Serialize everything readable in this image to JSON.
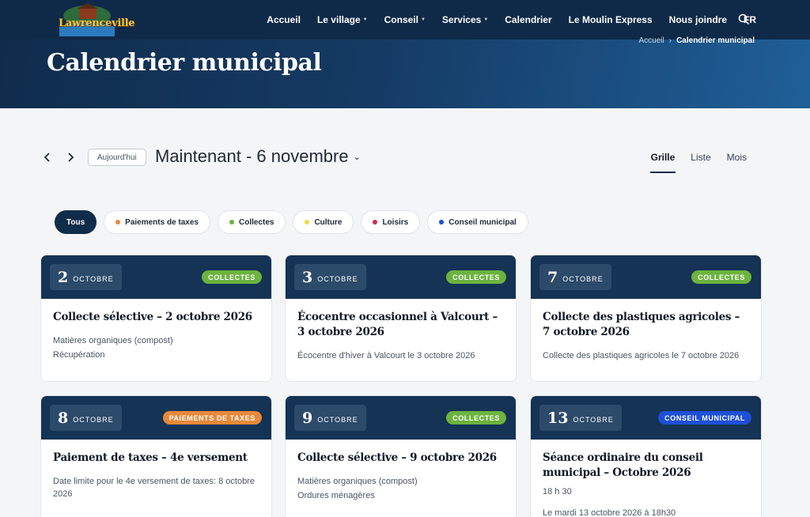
{
  "site": {
    "logo_text": "Lawrenceville"
  },
  "nav": [
    {
      "label": "Accueil",
      "caret": false
    },
    {
      "label": "Le village",
      "caret": true
    },
    {
      "label": "Conseil",
      "caret": true
    },
    {
      "label": "Services",
      "caret": true
    },
    {
      "label": "Calendrier",
      "caret": false
    },
    {
      "label": "Le Moulin Express",
      "caret": false
    },
    {
      "label": "Nous joindre",
      "caret": false
    },
    {
      "label": "FR",
      "caret": false
    }
  ],
  "breadcrumb": {
    "home": "Accueil",
    "separator": "›",
    "current": "Calendrier municipal"
  },
  "page": {
    "title": "Calendrier municipal"
  },
  "toolbar": {
    "today_label": "Aujourd'hui",
    "range_title": "Maintenant - 6 novembre",
    "views": [
      "Grille",
      "Liste",
      "Mois"
    ],
    "active_view": "Grille"
  },
  "filters": [
    {
      "label": "Tous",
      "color": null,
      "active": true
    },
    {
      "label": "Paiements de taxes",
      "color": "#e8893a"
    },
    {
      "label": "Collectes",
      "color": "#6cb33f"
    },
    {
      "label": "Culture",
      "color": "#f2d93b"
    },
    {
      "label": "Loisirs",
      "color": "#d6264f"
    },
    {
      "label": "Conseil municipal",
      "color": "#1e4fd6"
    }
  ],
  "events": [
    {
      "day": "2",
      "month": "OCTOBRE",
      "badge": "COLLECTES",
      "badge_color": "#6cb33f",
      "title": "Collecte sélective – 2 octobre 2026",
      "lines": [
        "Matières organiques (compost)",
        "Récupération"
      ]
    },
    {
      "day": "3",
      "month": "OCTOBRE",
      "badge": "COLLECTES",
      "badge_color": "#6cb33f",
      "title": "Écocentre occasionnel à Valcourt – 3 octobre 2026",
      "lines": [
        "Écocentre d'hiver à Valcourt le 3 octobre 2026"
      ]
    },
    {
      "day": "7",
      "month": "OCTOBRE",
      "badge": "COLLECTES",
      "badge_color": "#6cb33f",
      "title": "Collecte des plastiques agricoles – 7 octobre 2026",
      "lines": [
        "Collecte des plastiques agricoles le 7 octobre 2026"
      ]
    },
    {
      "day": "8",
      "month": "OCTOBRE",
      "badge": "PAIEMENTS DE TAXES",
      "badge_color": "#e8893a",
      "title": "Paiement de taxes – 4e versement",
      "lines": [
        "Date limite pour le 4e versement de taxes: 8 octobre 2026"
      ]
    },
    {
      "day": "9",
      "month": "OCTOBRE",
      "badge": "COLLECTES",
      "badge_color": "#6cb33f",
      "title": "Collecte sélective – 9 octobre 2026",
      "lines": [
        "Matières organiques (compost)",
        "Ordures ménagères"
      ]
    },
    {
      "day": "13",
      "month": "OCTOBRE",
      "badge": "CONSEIL MUNICIPAL",
      "badge_color": "#1e4fd6",
      "title": "Séance ordinaire du conseil municipal – Octobre 2026",
      "time": "18 h 30",
      "lines": [
        "Le mardi 13 octobre 2026 à 18h30"
      ]
    }
  ]
}
